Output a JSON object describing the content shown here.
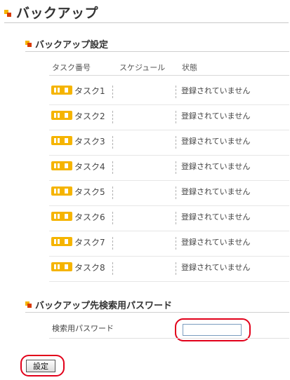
{
  "page": {
    "title": "バックアップ"
  },
  "backup_settings": {
    "heading": "バックアップ設定",
    "columns": [
      "タスク番号",
      "スケジュール",
      "状態"
    ],
    "tasks": [
      {
        "label": "タスク1",
        "schedule": "",
        "status": "登録されていません"
      },
      {
        "label": "タスク2",
        "schedule": "",
        "status": "登録されていません"
      },
      {
        "label": "タスク3",
        "schedule": "",
        "status": "登録されていません"
      },
      {
        "label": "タスク4",
        "schedule": "",
        "status": "登録されていません"
      },
      {
        "label": "タスク5",
        "schedule": "",
        "status": "登録されていません"
      },
      {
        "label": "タスク6",
        "schedule": "",
        "status": "登録されていません"
      },
      {
        "label": "タスク7",
        "schedule": "",
        "status": "登録されていません"
      },
      {
        "label": "タスク8",
        "schedule": "",
        "status": "登録されていません"
      }
    ]
  },
  "search_password": {
    "heading": "バックアップ先検索用パスワード",
    "label": "検索用パスワード",
    "value": ""
  },
  "submit": {
    "label": "設定"
  },
  "icons": {
    "task": "task-schedule-icon"
  },
  "colors": {
    "accent_orange": "#f5b400",
    "accent_red": "#d93a00",
    "highlight": "#e2001a"
  }
}
